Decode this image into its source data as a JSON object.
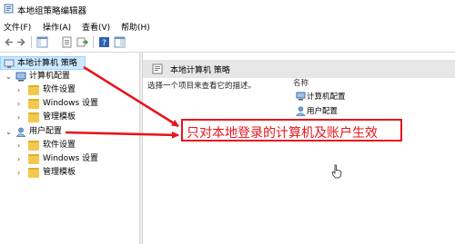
{
  "window": {
    "title": "本地组策略编辑器"
  },
  "menu": [
    {
      "label": "文件(F)"
    },
    {
      "label": "操作(A)"
    },
    {
      "label": "查看(V)"
    },
    {
      "label": "帮助(H)"
    }
  ],
  "tree": {
    "root": "本地计算机 策略",
    "computer": {
      "label": "计算机配置",
      "children": [
        "软件设置",
        "Windows 设置",
        "管理模板"
      ]
    },
    "user": {
      "label": "用户配置",
      "children": [
        "软件设置",
        "Windows 设置",
        "管理模板"
      ]
    }
  },
  "right_pane": {
    "header": "本地计算机 策略",
    "description": "选择一个项目来查看它的描述。",
    "column_name": "名称",
    "items": [
      "计算机配置",
      "用户配置"
    ]
  },
  "annotation": {
    "callout_text": "只对本地登录的计算机及账户生效",
    "color": "#e8141c"
  }
}
